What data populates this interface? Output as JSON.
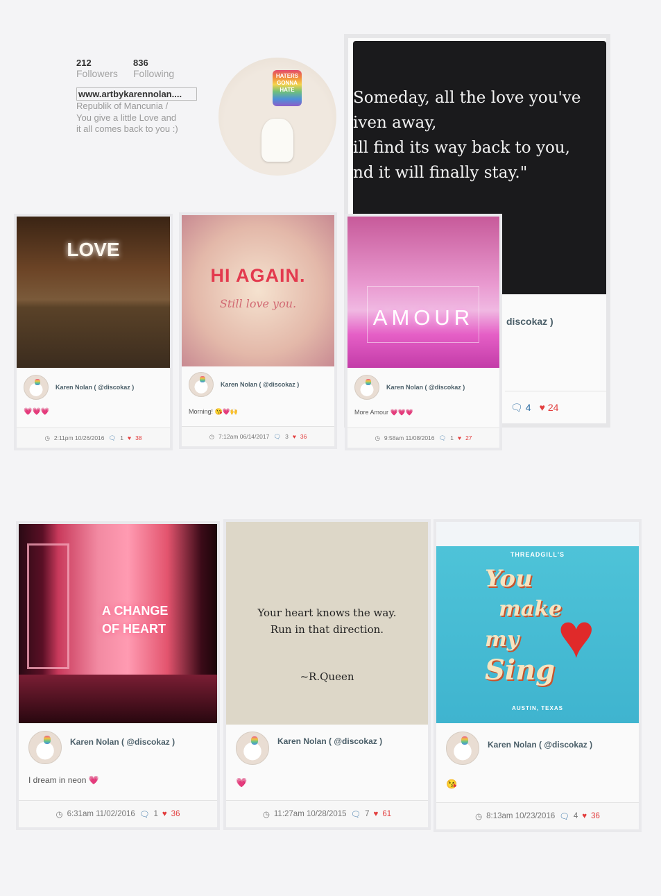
{
  "profile": {
    "followers_count": "212",
    "followers_label": "Followers",
    "following_count": "836",
    "following_label": "Following",
    "website": "www.artbykarennolan....",
    "bio_lines": [
      "Republik of Mancunia /",
      "You give a little Love and",
      "it all comes back to you :)"
    ],
    "avatar_text": "HATERS GONNA HATE"
  },
  "quote_post": {
    "lines": [
      "Someday, all the love you've",
      "iven away,",
      "ill find its way back to you,",
      "nd it will finally stay.\""
    ],
    "author_fragment": "discokaz )",
    "comments": "4",
    "likes": "24"
  },
  "posts_row1": [
    {
      "image_text": "LOVE",
      "author": "Karen Nolan ( @discokaz )",
      "caption": "💗💗💗",
      "time": "2:11pm 10/26/2016",
      "comments": "1",
      "likes": "38"
    },
    {
      "image_text": "HI AGAIN.",
      "image_subtext": "Still love you.",
      "author": "Karen Nolan ( @discokaz )",
      "caption": "Morning! 😘💗🙌",
      "time": "7:12am 06/14/2017",
      "comments": "3",
      "likes": "36"
    },
    {
      "image_text": "AMOUR",
      "author": "Karen Nolan ( @discokaz )",
      "caption": "More Amour 💗💗💗",
      "time": "9:58am 11/08/2016",
      "comments": "1",
      "likes": "27"
    }
  ],
  "posts_row2": [
    {
      "image_text": "A CHANGE OF HEART",
      "author": "Karen Nolan ( @discokaz )",
      "caption": "I dream in neon 💗",
      "time": "6:31am 11/02/2016",
      "comments": "1",
      "likes": "36"
    },
    {
      "image_lines": [
        "Your heart knows the way.",
        "Run in that direction.",
        "~R.Queen"
      ],
      "author": "Karen Nolan ( @discokaz )",
      "caption": "💗",
      "time": "11:27am 10/28/2015",
      "comments": "7",
      "likes": "61"
    },
    {
      "image_lines": [
        "THREADGILL'S",
        "You",
        "make",
        "my",
        "Sing",
        "AUSTIN, TEXAS"
      ],
      "author": "Karen Nolan ( @discokaz )",
      "caption": "😘",
      "time": "8:13am 10/23/2016",
      "comments": "4",
      "likes": "36"
    }
  ],
  "icons": {
    "clock": "clock-icon",
    "comment": "comment-icon",
    "heart": "heart-icon"
  }
}
